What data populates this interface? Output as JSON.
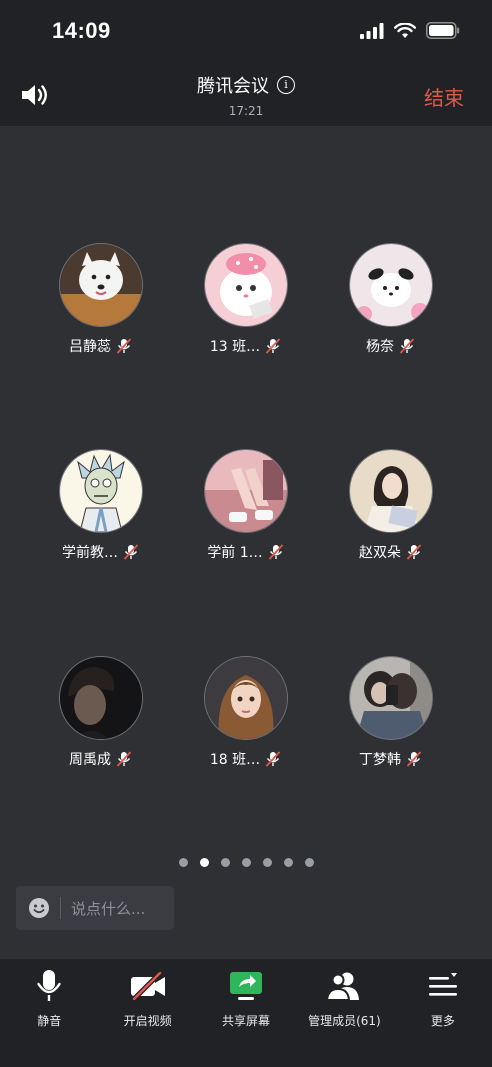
{
  "status_bar": {
    "time": "14:09"
  },
  "header": {
    "title": "腾讯会议",
    "elapsed": "17:21",
    "end_label": "结束"
  },
  "participants": [
    {
      "name": "吕静蕊"
    },
    {
      "name": "13 班…"
    },
    {
      "name": "杨奈"
    },
    {
      "name": "学前教…"
    },
    {
      "name": "学前 1…"
    },
    {
      "name": "赵双朵"
    },
    {
      "name": "周禹成"
    },
    {
      "name": "18 班…"
    },
    {
      "name": "丁梦韩"
    }
  ],
  "pagination": {
    "total_pages": 7,
    "current_page": 2
  },
  "chat": {
    "placeholder": "说点什么..."
  },
  "toolbar": {
    "mute": "静音",
    "video": "开启视频",
    "share": "共享屏幕",
    "members": "管理成员(61)",
    "more": "更多"
  },
  "colors": {
    "end": "#e2574c",
    "share_green": "#2fb55a",
    "video_off_red": "#e2574c"
  }
}
